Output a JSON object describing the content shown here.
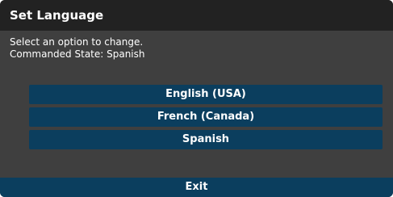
{
  "dialog": {
    "title": "Set Language",
    "message_line1": "Select an option to change.",
    "message_line2": "Commanded State: Spanish"
  },
  "options": [
    {
      "label": "English (USA)"
    },
    {
      "label": "French (Canada)"
    },
    {
      "label": "Spanish"
    }
  ],
  "footer": {
    "exit_label": "Exit"
  },
  "colors": {
    "dialog_bg": "#3f3f3f",
    "title_bg": "#222222",
    "button_bg": "#0b3e5e",
    "text": "#ffffff"
  }
}
